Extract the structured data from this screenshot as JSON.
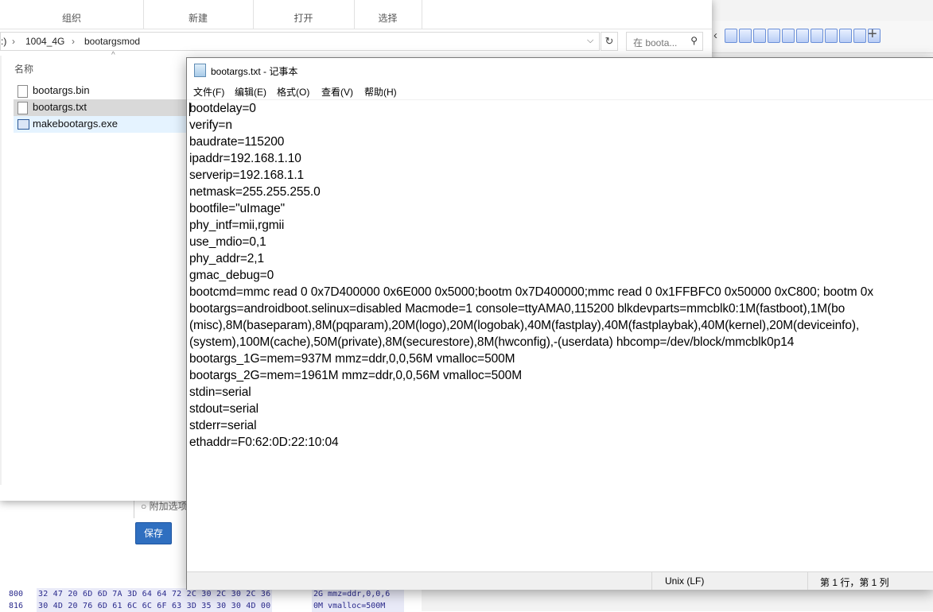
{
  "background": {
    "option_label": "附加选项",
    "save_button": "保存",
    "hex_rows": [
      {
        "addr": "800",
        "bytes": "32 47 20 6D 6D 7A 3D 64  64 72 2C 30 2C 30 2C 36",
        "ascii": "2G mmz=ddr,0,0,6"
      },
      {
        "addr": "816",
        "bytes": "30 4D 20 76 6D 61 6C 6C  6F 63 3D 35 30 30 4D 00",
        "ascii": "0M vmalloc=500M"
      }
    ]
  },
  "explorer": {
    "ribbon_groups": [
      "组织",
      "新建",
      "打开",
      "选择"
    ],
    "breadcrumb": [
      ":)",
      "1004_4G",
      "bootargsmod"
    ],
    "search_placeholder": "在 boota...",
    "column_name": "名称",
    "files": [
      {
        "name": "bootargs.bin",
        "state": "normal"
      },
      {
        "name": "bootargs.txt",
        "state": "selected"
      },
      {
        "name": "makebootargs.exe",
        "state": "hover"
      }
    ]
  },
  "notepad": {
    "title": "bootargs.txt - 记事本",
    "menu": [
      "文件(F)",
      "编辑(E)",
      "格式(O)",
      "查看(V)",
      "帮助(H)"
    ],
    "lines": [
      "bootdelay=0",
      "verify=n",
      "baudrate=115200",
      "ipaddr=192.168.1.10",
      "serverip=192.168.1.1",
      "netmask=255.255.255.0",
      "bootfile=\"uImage\"",
      "phy_intf=mii,rgmii",
      "use_mdio=0,1",
      "phy_addr=2,1",
      "gmac_debug=0",
      "bootcmd=mmc read 0 0x7D400000 0x6E000 0x5000;bootm 0x7D400000;mmc read 0 0x1FFBFC0 0x50000 0xC800; bootm 0x",
      "bootargs=androidboot.selinux=disabled Macmode=1 console=ttyAMA0,115200 blkdevparts=mmcblk0:1M(fastboot),1M(bo",
      "(misc),8M(baseparam),8M(pqparam),20M(logo),20M(logobak),40M(fastplay),40M(fastplaybak),40M(kernel),20M(deviceinfo),",
      "(system),100M(cache),50M(private),8M(securestore),8M(hwconfig),-(userdata) hbcomp=/dev/block/mmcblk0p14",
      "bootargs_1G=mem=937M mmz=ddr,0,0,56M vmalloc=500M",
      "bootargs_2G=mem=1961M mmz=ddr,0,0,56M vmalloc=500M",
      "stdin=serial",
      "stdout=serial",
      "stderr=serial",
      "ethaddr=F0:62:0D:22:10:04"
    ],
    "status": {
      "line_ending": "Unix (LF)",
      "position": "第 1 行，第 1 列"
    }
  }
}
